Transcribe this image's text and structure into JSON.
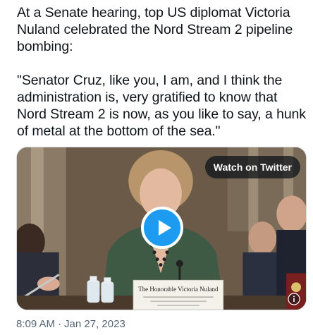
{
  "tweet": {
    "paragraph_1": "At a Senate hearing, top US diplomat Victoria Nuland celebrated the Nord Stream 2 pipeline bombing:",
    "paragraph_2": "\"Senator Cruz, like you, I am, and I think the administration is, very gratified to know that Nord Stream 2 is now, as you like to say, a hunk of metal at the bottom of the sea.\""
  },
  "media": {
    "watch_label": "Watch on Twitter",
    "nameplate_line_1": "The Honorable Victoria Nuland",
    "play_icon": "play-icon",
    "info_icon": "info-icon"
  },
  "meta": {
    "time": "8:09 AM",
    "separator": "·",
    "date": "Jan 27, 2023"
  },
  "colors": {
    "accent": "#1d9bf0",
    "text": "#0f1419",
    "muted": "#536471",
    "border": "#cfd9de"
  }
}
